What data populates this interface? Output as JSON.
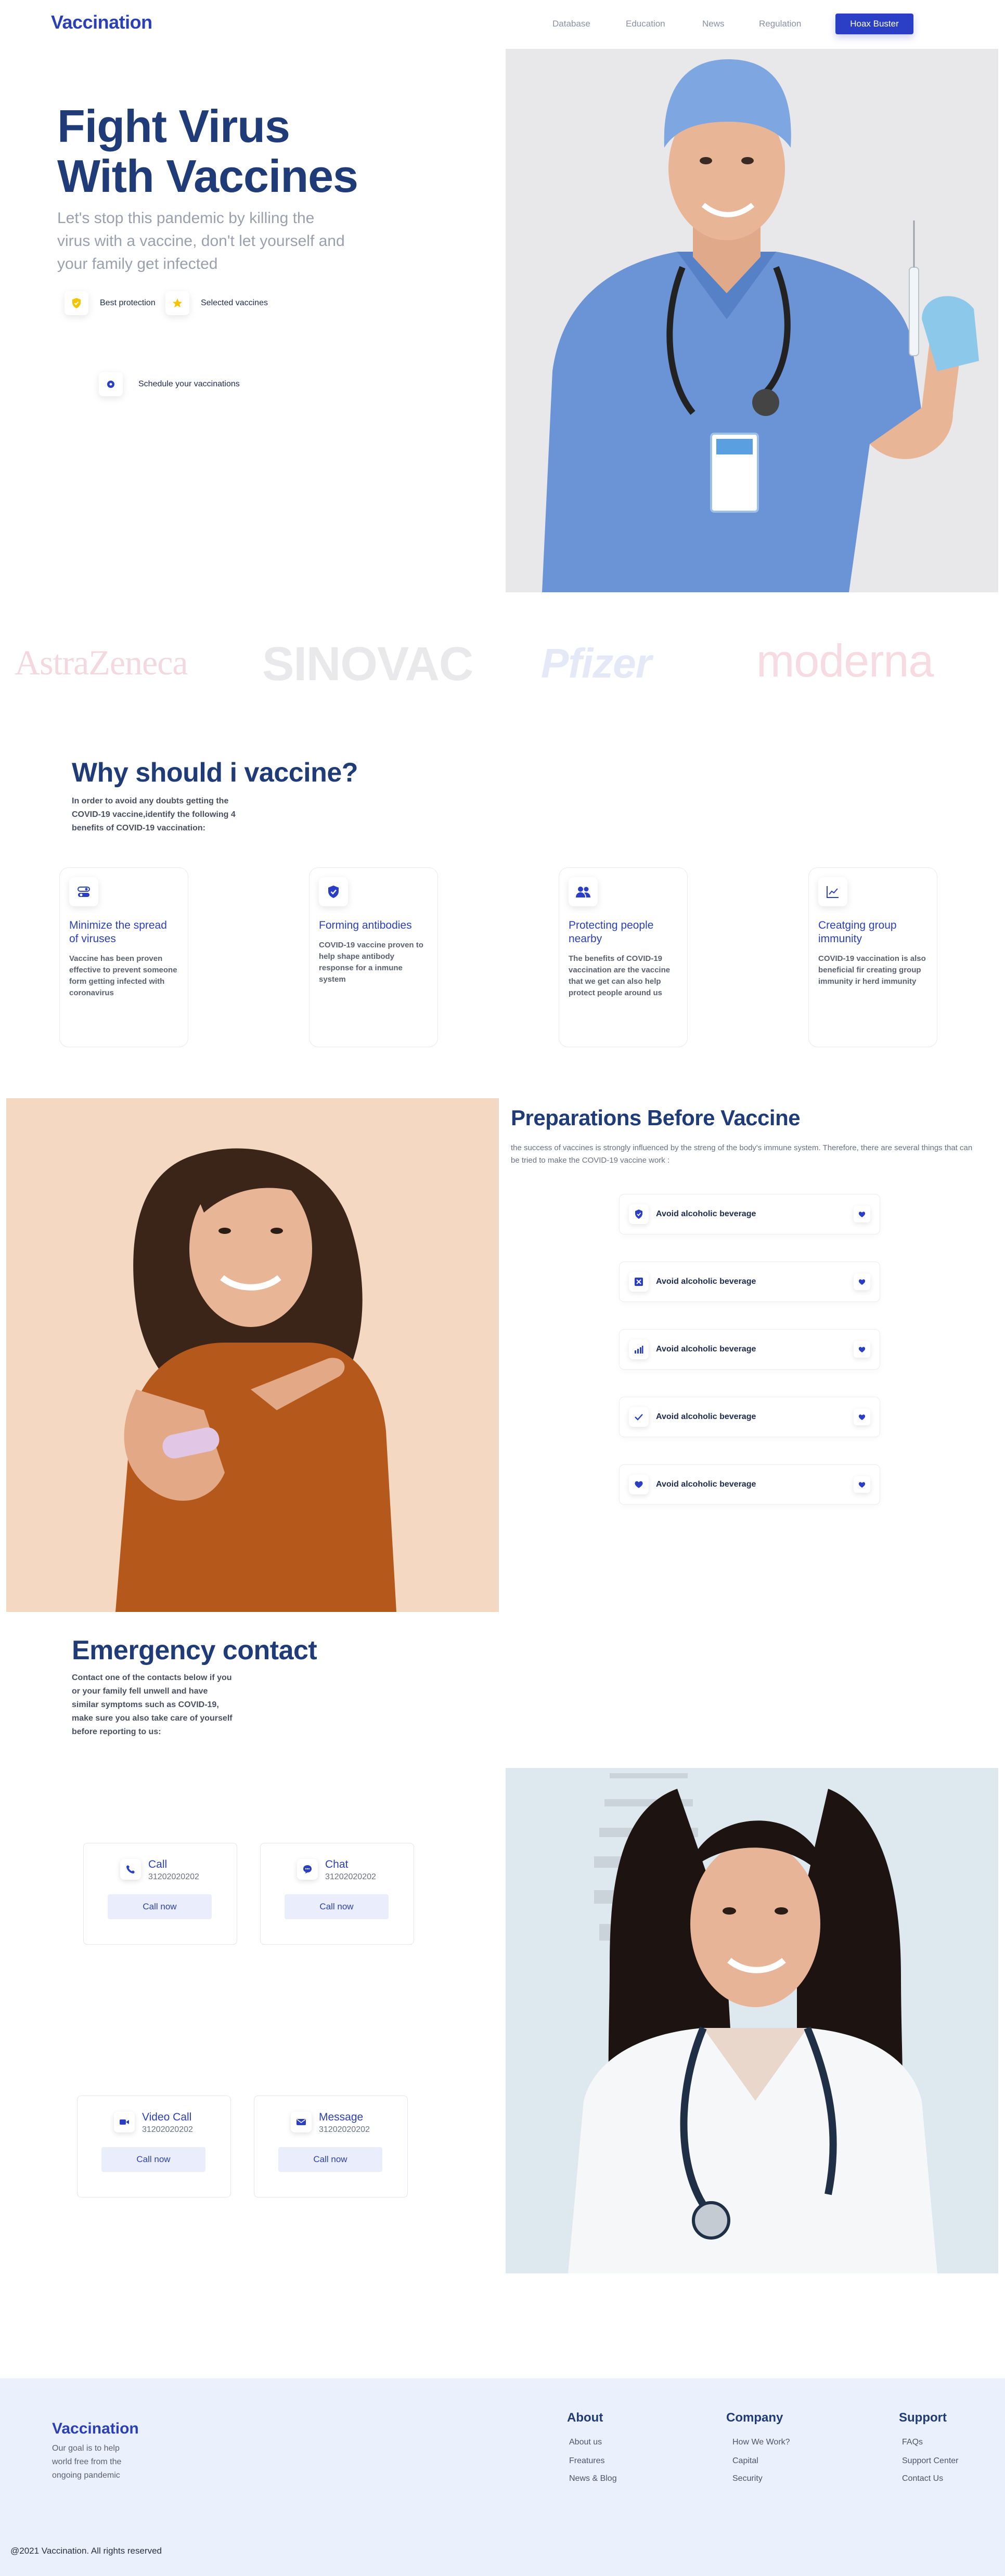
{
  "nav": {
    "logo": "Vaccination",
    "links": [
      "Database",
      "Education",
      "News",
      "Regulation"
    ],
    "cta": "Hoax Buster"
  },
  "hero": {
    "title_line1": "Fight Virus",
    "title_line2": "With Vaccines",
    "subtitle": "Let's stop this pandemic by killing the virus with a vaccine, don't let yourself and your family get infected",
    "badges": [
      "Best protection",
      "Selected vaccines"
    ],
    "schedule": "Schedule your vaccinations",
    "badge_color": "#f5c400"
  },
  "brands": [
    "AstraZeneca",
    "SINOVAC",
    "Pfizer",
    "moderna"
  ],
  "why": {
    "title": "Why should i vaccine?",
    "text": "In order to avoid any doubts getting the COVID-19 vaccine,identify the following 4 benefits of COVID-19 vaccination:",
    "cards": [
      {
        "title": "Minimize the spread of viruses",
        "text": "Vaccine has been proven effective to prevent someone form getting infected with coronavirus",
        "icon": "toggle-icon"
      },
      {
        "title": "Forming antibodies",
        "text": "COVID-19 vaccine proven to help shape antibody response for a inmune system",
        "icon": "shield-check-icon"
      },
      {
        "title": "Protecting people nearby",
        "text": "The benefits of COVID-19 vaccination are the vaccine that we get can also help protect people around us",
        "icon": "people-icon"
      },
      {
        "title": "Creatging group immunity",
        "text": "COVID-19 vaccination is also beneficial fir creating group immunity ir herd immunity",
        "icon": "chart-icon"
      }
    ]
  },
  "prep": {
    "title": "Preparations Before Vaccine",
    "text": "the success of vaccines is strongly influenced by the streng of the body's immune system. Therefore, there are several things that can be tried to make the COVID-19 vaccine work :",
    "items": [
      {
        "label": "Avoid alcoholic beverage",
        "icon": "shield-icon"
      },
      {
        "label": "Avoid alcoholic beverage",
        "icon": "cross-box-icon"
      },
      {
        "label": "Avoid alcoholic beverage",
        "icon": "bars-icon"
      },
      {
        "label": "Avoid alcoholic beverage",
        "icon": "check-icon"
      },
      {
        "label": "Avoid alcoholic beverage",
        "icon": "heart-icon"
      }
    ]
  },
  "emergency": {
    "title": "Emergency contact",
    "text": "Contact one of the contacts below if you or your family fell unwell and have similar symptoms such as COVID-19, make sure you also take care of yourself before reporting to us:",
    "contacts": [
      {
        "title": "Call",
        "number": "31202020202",
        "button": "Call now",
        "icon": "phone-icon"
      },
      {
        "title": "Chat",
        "number": "31202020202",
        "button": "Call now",
        "icon": "chat-icon"
      },
      {
        "title": "Video Call",
        "number": "31202020202",
        "button": "Call now",
        "icon": "video-icon"
      },
      {
        "title": "Message",
        "number": "31202020202",
        "button": "Call now",
        "icon": "mail-icon"
      }
    ]
  },
  "footer": {
    "logo": "Vaccination",
    "tagline": "Our goal is to help world free from the ongoing pandemic",
    "columns": [
      {
        "title": "About",
        "links": [
          "About us",
          "Freatures",
          "News & Blog"
        ]
      },
      {
        "title": "Company",
        "links": [
          "How We Work?",
          "Capital",
          "Security"
        ]
      },
      {
        "title": "Support",
        "links": [
          "FAQs",
          "Support Center",
          "Contact Us"
        ]
      }
    ],
    "copyright": "@2021 Vaccination. All rights reserved"
  },
  "colors": {
    "primary": "#2a3fc6",
    "heading": "#1f3b78",
    "footer_bg": "#eaf0fc"
  }
}
